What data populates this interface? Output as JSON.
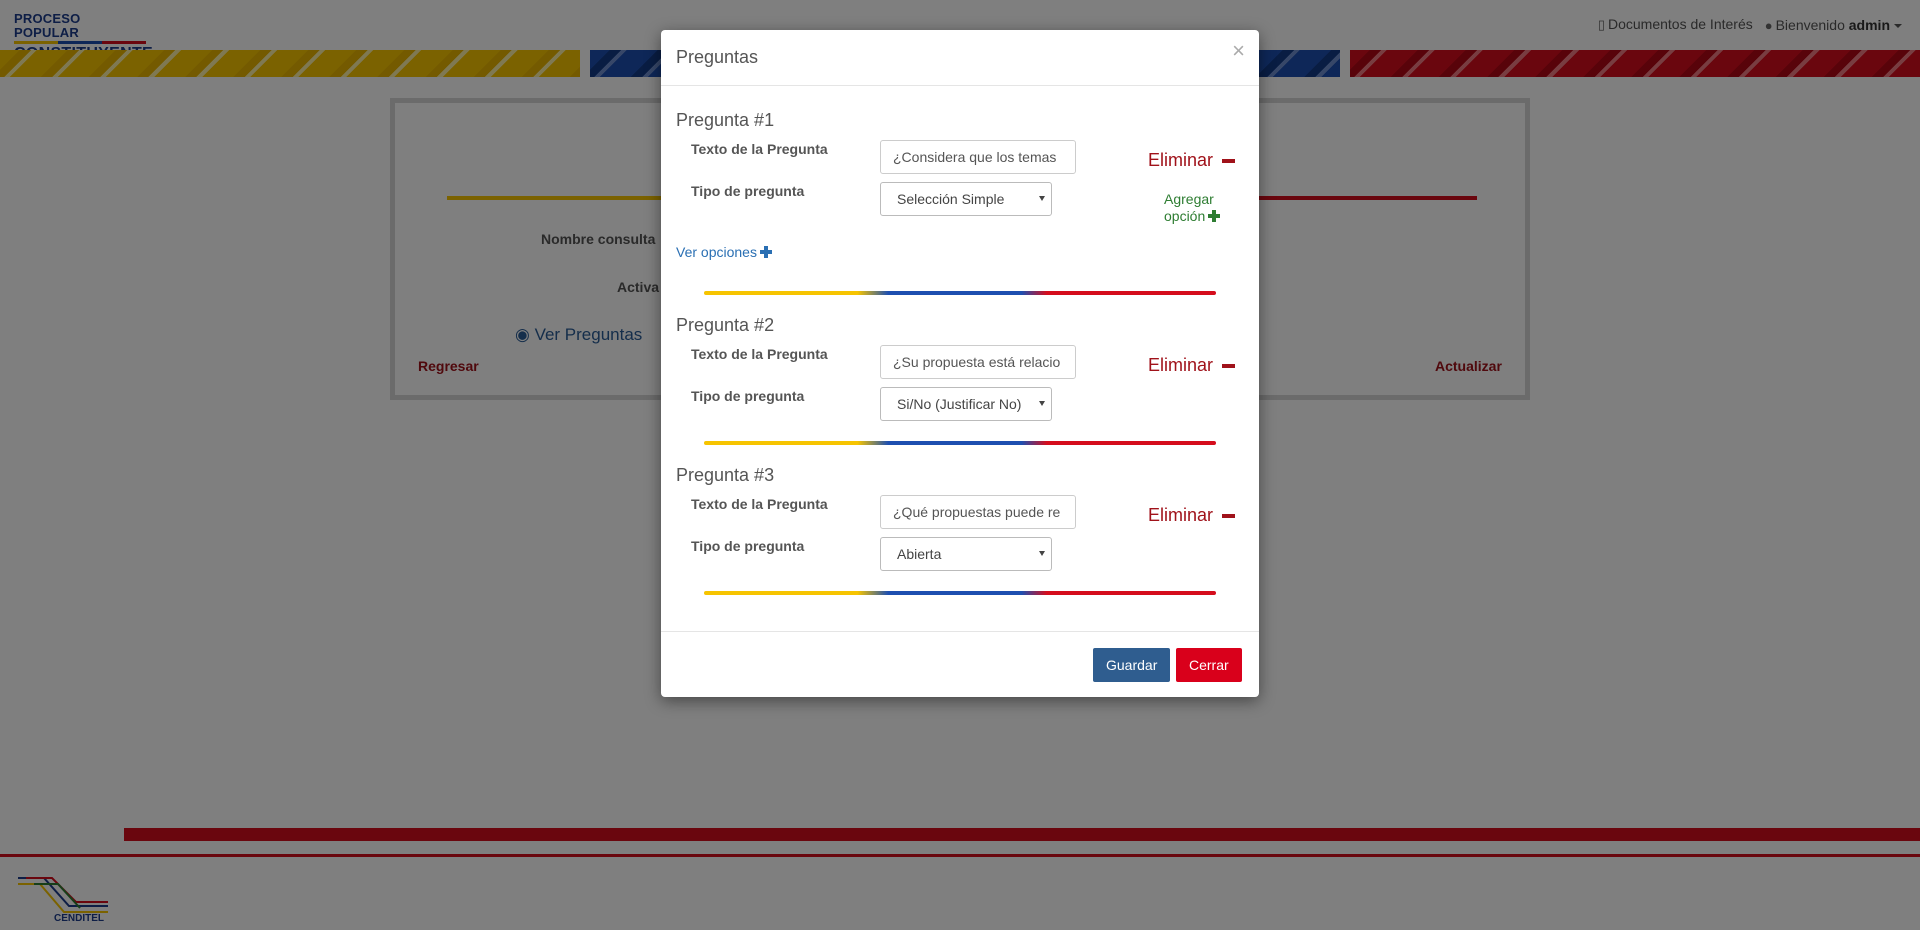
{
  "header": {
    "logo_line1": "PROCESO POPULAR",
    "logo_line2": "CONSTITUYENTE",
    "documents_link": "Documentos de Interés",
    "welcome_text": "Bienvenido",
    "user": "admin"
  },
  "background_form": {
    "label_name": "Nombre consulta",
    "label_active": "Activa",
    "view_questions": "Ver Preguntas",
    "back": "Regresar",
    "update": "Actualizar"
  },
  "footer": {
    "logo_text": "CENDITEL"
  },
  "modal": {
    "title": "Preguntas",
    "close_symbol": "×",
    "text_label": "Texto de la Pregunta",
    "type_label": "Tipo de pregunta",
    "delete_label": "Eliminar",
    "add_option_line1": "Agregar",
    "add_option_line2": "opción",
    "view_options": "Ver opciones",
    "questions": [
      {
        "title": "Pregunta #1",
        "text": "¿Considera que los temas",
        "type": "Selección Simple"
      },
      {
        "title": "Pregunta #2",
        "text": "¿Su propuesta está relacio",
        "type": "Si/No (Justificar No)"
      },
      {
        "title": "Pregunta #3",
        "text": "¿Qué propuestas puede re",
        "type": "Abierta"
      }
    ],
    "save_button": "Guardar",
    "close_button": "Cerrar"
  },
  "colors": {
    "yellow": "#f6c400",
    "blue": "#1d4fb0",
    "red": "#d50d1c",
    "primary": "#2f5d8f",
    "danger": "#d9001b"
  }
}
